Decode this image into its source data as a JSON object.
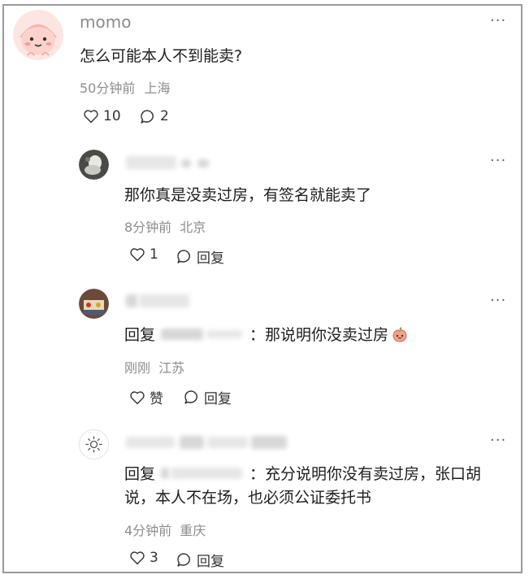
{
  "more_label": "···",
  "main_comment": {
    "username": "momo",
    "text": "怎么可能本人不到能卖?",
    "time": "50分钟前",
    "location": "上海",
    "likes": "10",
    "replies": "2"
  },
  "replies": [
    {
      "text": "那你真是没卖过房，有签名就能卖了",
      "time": "8分钟前",
      "location": "北京",
      "likes": "1",
      "reply_label": "回复"
    },
    {
      "reply_prefix": "回复",
      "text": "：那说明你没卖过房",
      "time": "刚刚",
      "location": "江苏",
      "like_label": "赞",
      "reply_label": "回复"
    },
    {
      "reply_prefix": "回复",
      "text": "：充分说明你没有卖过房，张口胡说，本人不在场，也必须公证委托书",
      "time": "4分钟前",
      "location": "重庆",
      "likes": "3",
      "reply_label": "回复"
    }
  ]
}
